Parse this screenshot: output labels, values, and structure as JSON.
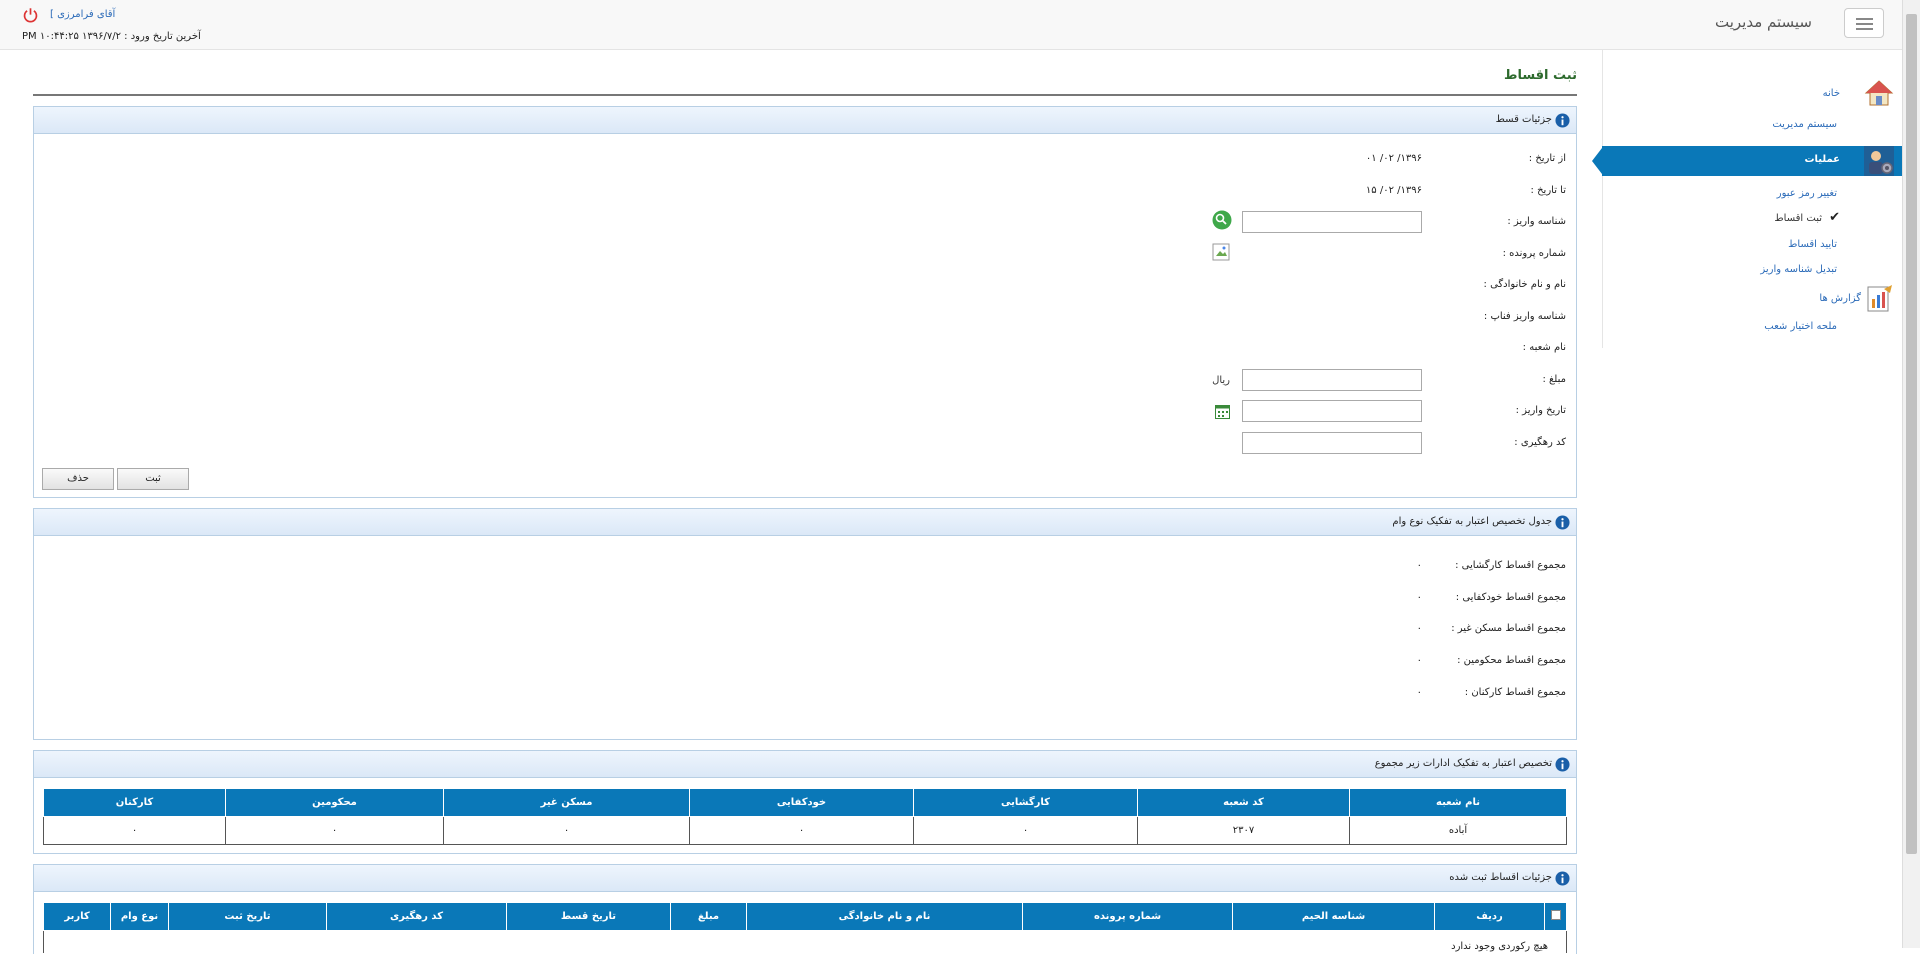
{
  "header": {
    "brand": "سیستم مدیریت",
    "user_name": "آقای فرامرزی ]",
    "last_login": "آخرین تاریخ ورود : ۱۳۹۶/۷/۲ ۱۰:۴۴:۲۵ PM"
  },
  "sidebar": {
    "items": [
      {
        "label": "خانه",
        "icon": "home-icon"
      },
      {
        "label": "سیستم مدیریت"
      },
      {
        "label": "عملیات",
        "icon": "operations-user-icon"
      },
      {
        "label": "تغییر رمز عبور"
      },
      {
        "label": "ثبت اقساط",
        "icon": "checkmark-icon"
      },
      {
        "label": "تایید اقساط"
      },
      {
        "label": "تبدیل شناسه واریز"
      },
      {
        "label": "گزارش ها",
        "icon": "report-chart-icon"
      },
      {
        "label": "ملحه اختیار شعب"
      }
    ]
  },
  "page": {
    "title": "ثبت اقساط"
  },
  "details": {
    "title": "جزئیات قسط",
    "from_label": "از تاریخ :",
    "from_value": "۱۳۹۶/ ۰۲/ ۰۱",
    "to_label": "تا تاریخ :",
    "to_value": "۱۳۹۶/ ۰۲/ ۱۵",
    "deposit_id_label": "شناسه واریز :",
    "deposit_id_value": "",
    "file_no_label": "شماره پرونده :",
    "name_label": "نام و نام خانوادگی :",
    "fanap_label": "شناسه واریز فناپ :",
    "branch_label": "نام شعبه :",
    "amount_label": "مبلغ :",
    "amount_value": "",
    "amount_unit": "ریال",
    "date_label": "تاریخ واریز :",
    "date_value": "",
    "tracking_label": "کد رهگیری :",
    "tracking_value": "",
    "submit_label": "ثبت",
    "delete_label": "حذف"
  },
  "allocation": {
    "title": "جدول تخصیص اعتبار به تفکیک نوع وام",
    "rows": [
      {
        "label": "مجموع اقساط کارگشایی :",
        "value": "۰"
      },
      {
        "label": "مجموع اقساط خودکفایی :",
        "value": "۰"
      },
      {
        "label": "مجموع اقساط مسکن غیر :",
        "value": "۰"
      },
      {
        "label": "مجموع اقساط محکومین :",
        "value": "۰"
      },
      {
        "label": "مجموع اقساط کارکنان :",
        "value": "۰"
      }
    ]
  },
  "branches": {
    "title": "تخصیص اعتبار به تفکیک ادارات زیر مجموع",
    "headers": [
      "نام شعبه",
      "کد شعبه",
      "کارگشایی",
      "خودکفایی",
      "مسکن غیر",
      "محکومین",
      "کارکنان"
    ],
    "rows": [
      [
        "آباده",
        "۲۳۰۷",
        "۰",
        "۰",
        "۰",
        "۰",
        "۰"
      ]
    ]
  },
  "registered": {
    "title": "جزئیات اقساط ثبت شده",
    "headers": [
      "",
      "ردیف",
      "شناسه الحیم",
      "شماره پرونده",
      "نام و نام خانوادگی",
      "مبلغ",
      "تاریخ قسط",
      "کد رهگیری",
      "تاریخ ثبت",
      "نوع وام",
      "کاربر"
    ],
    "empty_text": "هیچ رکوردی وجود ندارد"
  }
}
